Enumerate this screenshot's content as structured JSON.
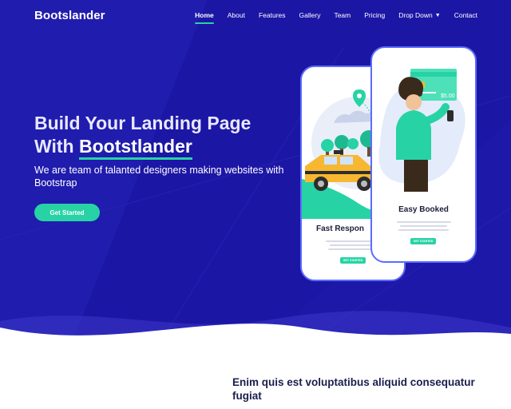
{
  "header": {
    "logo": "Bootslander",
    "nav": [
      {
        "label": "Home",
        "active": true
      },
      {
        "label": "About"
      },
      {
        "label": "Features"
      },
      {
        "label": "Gallery"
      },
      {
        "label": "Team"
      },
      {
        "label": "Pricing"
      },
      {
        "label": "Drop Down",
        "has_dropdown": true
      },
      {
        "label": "Contact"
      }
    ]
  },
  "hero": {
    "title_line1": "Build Your Landing Page",
    "title_line2_prefix": "With ",
    "title_brand": "Bootstlander",
    "subtitle": "We are team of talanted designers making websites with Bootstrap",
    "cta_label": "Get Started"
  },
  "phones": {
    "left": {
      "label": "Fast Respon",
      "button": "GET STARTED"
    },
    "right": {
      "label": "Easy Booked",
      "button": "GET STARTED",
      "price": "$5.00"
    }
  },
  "section": {
    "title": "Enim quis est voluptatibus aliquid consequatur fugiat"
  },
  "colors": {
    "hero_bg": "#1e18a8",
    "accent": "#27d3a5",
    "phone_border": "#5b6cff",
    "heading_dark": "#1a1f4e"
  }
}
